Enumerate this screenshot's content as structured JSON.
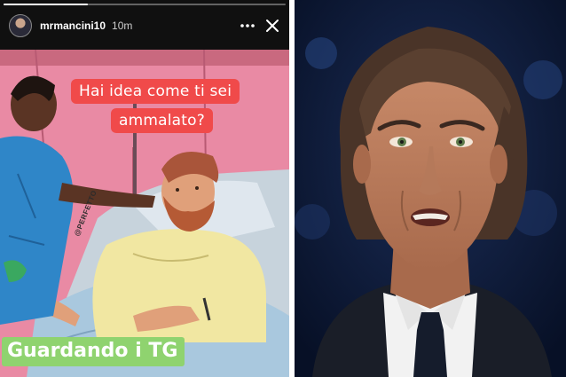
{
  "story": {
    "username": "mrmancini10",
    "timestamp": "10m",
    "progress": 0.3,
    "icons": {
      "more": "more-dots-icon",
      "close": "close-icon"
    }
  },
  "comic": {
    "speech_line_1": "Hai idea come ti sei",
    "speech_line_2": "ammalato?",
    "watermark": "@PERFETTO",
    "caption": "Guardando i TG",
    "colors": {
      "speech_bg": "#f04a4a",
      "caption_bg": "#8fd36f",
      "wall": "#e98aa4"
    }
  },
  "photo": {
    "colors": {
      "background": "#0d1b3a",
      "shirt": "#f2f2f2",
      "tie": "#151c2c",
      "jacket": "#1a1e28"
    }
  }
}
